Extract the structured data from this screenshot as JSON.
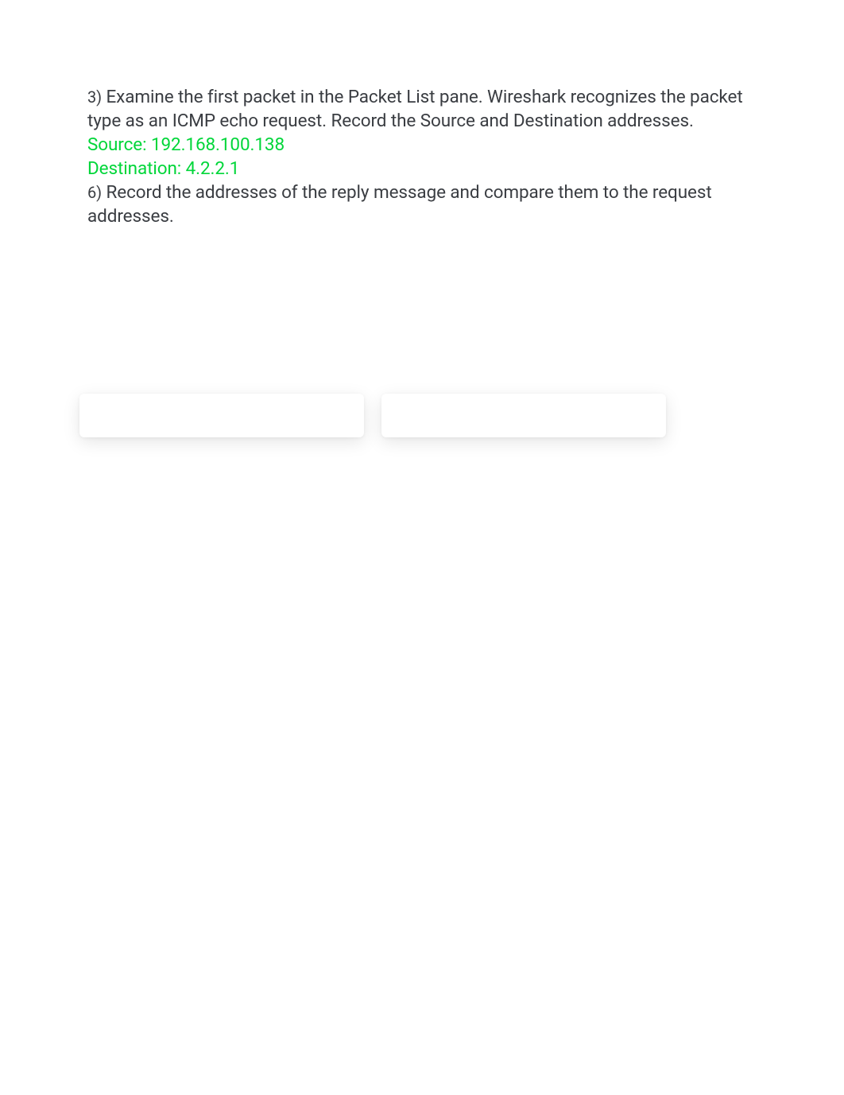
{
  "q3": {
    "number": "3)",
    "text": " Examine the first packet in the Packet List pane. Wireshark recognizes the packet type as an ICMP echo request. Record the Source and Destination addresses."
  },
  "answers": {
    "source": "Source: 192.168.100.138",
    "destination": "Destination: 4.2.2.1"
  },
  "q6": {
    "number": "6)",
    "text": " Record the addresses of the reply message and compare them to the request addresses."
  }
}
